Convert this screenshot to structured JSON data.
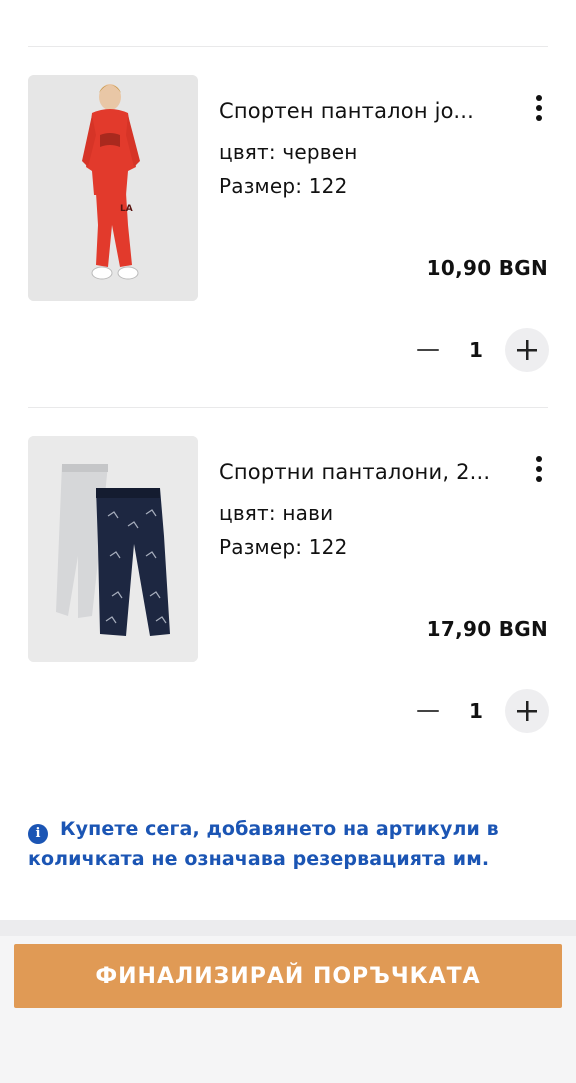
{
  "cart": {
    "items": [
      {
        "title": "Спортен панталон jo...",
        "color": "цвят: червен",
        "size": "Размер: 122",
        "price": "10,90 BGN",
        "quantity": "1",
        "image_icon": "product-photo-red-tracksuit"
      },
      {
        "title": "Спортни панталони, 2...",
        "color": "цвят: нави",
        "size": "Размер: 122",
        "price": "17,90 BGN",
        "quantity": "1",
        "image_icon": "product-photo-two-pants"
      }
    ]
  },
  "notice": {
    "icon": "info-icon",
    "text": "Купете сега, добавянето на артикули в количката не означава резервацията им."
  },
  "checkout": {
    "label": "ФИНАЛИЗИРАЙ ПОРЪЧКАТА",
    "color": "#e09a55"
  },
  "colors": {
    "notice_blue": "#1b55b4",
    "plus_bg": "#eeeef0"
  }
}
